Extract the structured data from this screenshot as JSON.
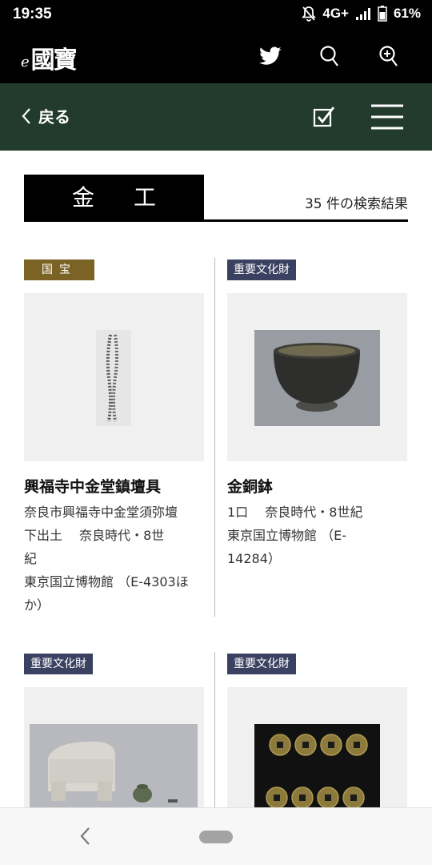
{
  "status": {
    "time": "19:35",
    "network": "4G+",
    "battery": "61%"
  },
  "app": {
    "logo_e": "e",
    "logo_text": "國寶"
  },
  "nav": {
    "back_label": "戻る"
  },
  "category": {
    "title": "金 工",
    "result_count": "35 件の検索結果"
  },
  "items": [
    {
      "badge": "国宝",
      "title": "興福寺中金堂鎮壇具",
      "desc": "奈良市興福寺中金堂須弥壇\n下出土　 奈良時代・8世\n紀\n東京国立博物館 （E-4303ほ\nか）"
    },
    {
      "badge": "重要文化財",
      "title": "金銅鉢",
      "desc": "1口　 奈良時代・8世紀\n東京国立博物館 （E-\n14284）"
    },
    {
      "badge": "重要文化財"
    },
    {
      "badge": "重要文化財"
    }
  ],
  "colors": {
    "nav_bg": "#223b2c",
    "kokuho_badge": "#7b6325",
    "jubun_badge": "#3b4160"
  }
}
